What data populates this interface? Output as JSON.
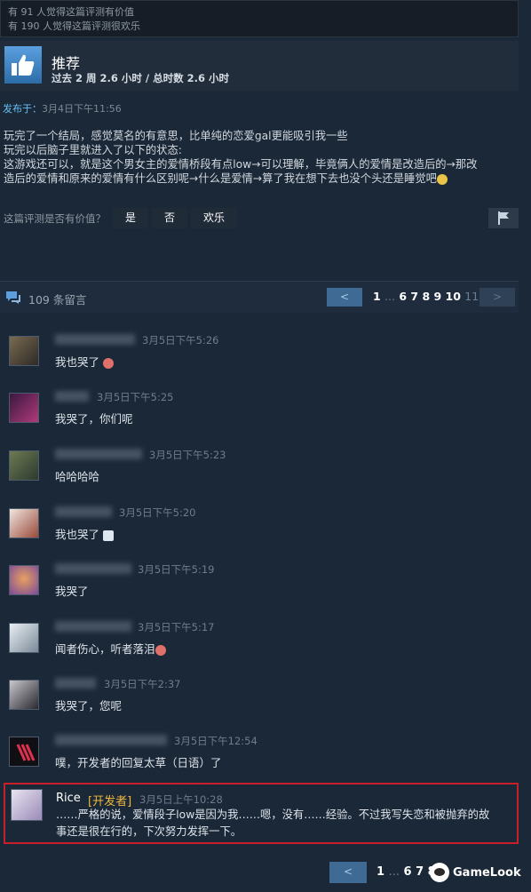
{
  "helpful": {
    "line1": "有 91 人觉得这篇评测有价值",
    "line2": "有 190 人觉得这篇评测很欢乐"
  },
  "recommendation": {
    "title": "推荐",
    "hours": "过去 2 周 2.6 小时 / 总时数 2.6 小时",
    "icon": "thumbs-up-icon"
  },
  "posted": {
    "label": "发布于：",
    "date": "3月4日下午11:56"
  },
  "review": {
    "line1": "玩完了一个结局，感觉莫名的有意思，比单纯的恋爱gal更能吸引我一些",
    "line2": "玩完以后脑子里就进入了以下的状态:",
    "line3": "这游戏还可以，就是这个男女主的爱情桥段有点low→可以理解，毕竟俩人的爱情是改造后的→那改",
    "line4": "造后的爱情和原来的爱情有什么区别呢→什么是爱情→算了我在想下去也没个头还是睡觉吧"
  },
  "vote": {
    "question": "这篇评测是否有价值？",
    "yes": "是",
    "no": "否",
    "funny": "欢乐"
  },
  "comments_header": {
    "count": "109 条留言",
    "prev": "<",
    "next": ">",
    "page_current": "1",
    "ellipsis": "...",
    "pages": "6 7 8 9 10",
    "last_page": "11"
  },
  "comments": [
    {
      "time": "3月5日下午5:26",
      "text": "我也哭了"
    },
    {
      "time": "3月5日下午5:25",
      "text": "我哭了，你们呢"
    },
    {
      "time": "3月5日下午5:23",
      "text": "哈哈哈哈"
    },
    {
      "time": "3月5日下午5:20",
      "text": "我也哭了"
    },
    {
      "time": "3月5日下午5:19",
      "text": "我哭了"
    },
    {
      "time": "3月5日下午5:17",
      "text": "闻者伤心，听者落泪"
    },
    {
      "time": "3月5日下午2:37",
      "text": "我哭了，您呢"
    },
    {
      "time": "3月5日下午12:54",
      "text": "噗，开发者的回复太草（日语）了"
    }
  ],
  "dev_comment": {
    "name": "Rice",
    "badge": "[开发者]",
    "time": "3月5日上午10:28",
    "line1": "……严格的说，爱情段子low是因为我……嗯，没有……经验。不过我写失恋和被抛弃的故",
    "line2": "事还是很在行的，下次努力发挥一下。"
  },
  "bottom_pager": {
    "prev": "<",
    "page_current": "1",
    "ellipsis": "...",
    "pages": "6 7 8"
  },
  "watermark": {
    "text": "GameLook"
  },
  "colors": {
    "background": "#1b2838",
    "link_blue": "#66c0f4",
    "developer_badge": "#f0b83c",
    "highlight_border": "#c8202a"
  }
}
